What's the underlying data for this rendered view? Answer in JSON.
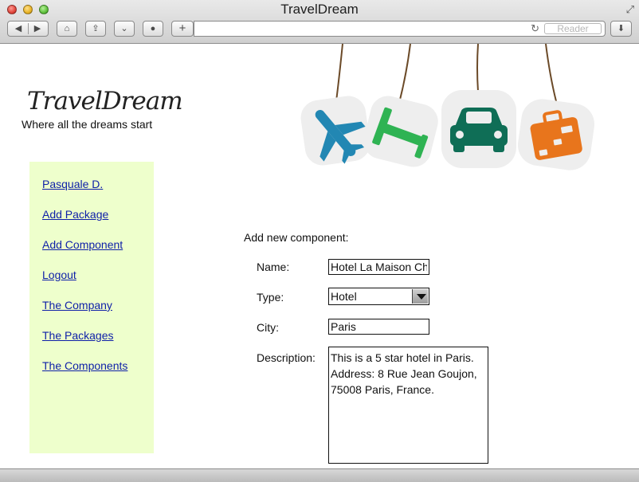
{
  "window": {
    "title": "TravelDream"
  },
  "toolbar": {
    "back_glyph": "◀",
    "forward_glyph": "▶",
    "home_glyph": "⌂",
    "share_glyph": "⇪",
    "pocket_glyph": "⌄",
    "ghostery_glyph": "●",
    "add_tab_glyph": "+",
    "reload_glyph": "↻",
    "reader_label": "Reader",
    "download_glyph": "⬇",
    "fullscreen_glyph": "⤢",
    "address_value": ""
  },
  "site": {
    "logo": "TravelDream",
    "tagline": "Where all the dreams start"
  },
  "hero": {
    "tag_icons": [
      "airplane-icon",
      "bed-icon",
      "car-icon",
      "suitcase-icon"
    ],
    "colors": {
      "plane": "#2287b3",
      "bed": "#2fb353",
      "car": "#0f6e56",
      "suitcase": "#e8751c",
      "string": "#6b4a28"
    }
  },
  "sidebar": {
    "background": "#eeffcc",
    "items": [
      {
        "label": "Pasquale D."
      },
      {
        "label": "Add Package"
      },
      {
        "label": "Add Component"
      },
      {
        "label": "Logout"
      },
      {
        "label": "The Company"
      },
      {
        "label": "The Packages"
      },
      {
        "label": "The Components"
      }
    ]
  },
  "form": {
    "title": "Add new component:",
    "name_label": "Name:",
    "name_value": "Hotel La Maison Champs Elysées",
    "type_label": "Type:",
    "type_value": "Hotel",
    "city_label": "City:",
    "city_value": "Paris",
    "description_label": "Description:",
    "description_value": "This is a 5 star hotel in Paris. Address: 8 Rue Jean Goujon, 75008 Paris, France."
  }
}
